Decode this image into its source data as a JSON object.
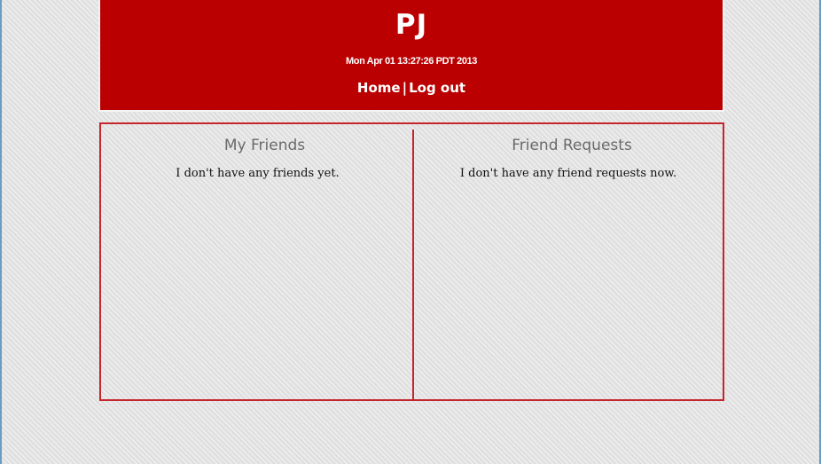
{
  "header": {
    "title": "PJ",
    "timestamp": "Mon Apr 01 13:27:26 PDT 2013",
    "nav": {
      "home_label": "Home",
      "separator": "|",
      "logout_label": "Log out"
    }
  },
  "friends": {
    "title": "My Friends",
    "empty_text": "I don't have any friends yet."
  },
  "requests": {
    "title": "Friend Requests",
    "empty_text": "I don't have any friend requests now."
  },
  "colors": {
    "header_bg": "#ba0000",
    "panel_border": "#c4262e",
    "page_frame": "#6b9cc2"
  }
}
